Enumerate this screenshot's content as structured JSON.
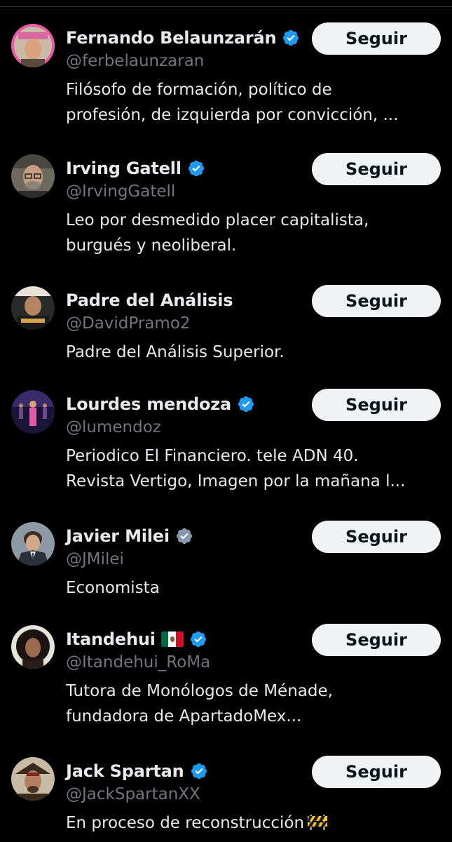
{
  "colors": {
    "background": "#000000",
    "primary_text": "#e7e9ea",
    "secondary_text": "#71767b",
    "verified_blue": "#1d9bf0",
    "verified_gray": "#829aab",
    "button_bg": "#eff3f4",
    "button_text": "#0f1419"
  },
  "follow_label": "Seguir",
  "users": [
    {
      "name": "Fernando Belaunzarán",
      "handle": "@ferbelaunzaran",
      "verified": "blue",
      "avatar_icon": "avatar-fernando",
      "bio": [
        "Filósofo de formación, político de",
        "profesión, de izquierda por convicción, ..."
      ]
    },
    {
      "name": "Irving Gatell",
      "handle": "@IrvingGatell",
      "verified": "blue",
      "avatar_icon": "avatar-irving",
      "bio": [
        "Leo por desmedido placer capitalista,",
        "burgués y neoliberal."
      ]
    },
    {
      "name": "Padre del Análisis",
      "handle": "@DavidPramo2",
      "verified": "none",
      "avatar_icon": "avatar-padre",
      "bio": [
        "Padre del Análisis Superior."
      ]
    },
    {
      "name": "Lourdes mendoza",
      "handle": "@lumendoz",
      "verified": "blue",
      "avatar_icon": "avatar-lourdes",
      "bio": [
        "Periodico El Financiero. tele ADN 40.",
        "Revista Vertigo, Imagen por la mañana l..."
      ]
    },
    {
      "name": "Javier Milei",
      "handle": "@JMilei",
      "verified": "gray",
      "avatar_icon": "avatar-milei",
      "bio": [
        "Economista"
      ]
    },
    {
      "name": "Itandehui",
      "name_emoji": "mexico-flag",
      "handle": "@Itandehui_RoMa",
      "verified": "blue",
      "avatar_icon": "avatar-itandehui",
      "bio": [
        "Tutora de Monólogos de Ménade,",
        "fundadora de ApartadoMex..."
      ]
    },
    {
      "name": "Jack Spartan",
      "handle": "@JackSpartanXX",
      "verified": "blue",
      "avatar_icon": "avatar-jack",
      "bio": [
        "En proceso de reconstrucción"
      ],
      "bio_emoji": "construction-barrier"
    }
  ]
}
